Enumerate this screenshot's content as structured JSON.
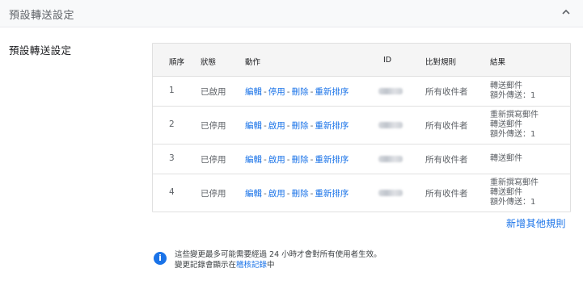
{
  "header": {
    "title": "預設轉送設定",
    "chevron_icon": "chevron-up-icon"
  },
  "section": {
    "label": "預設轉送設定"
  },
  "table": {
    "columns": [
      "順序",
      "狀態",
      "動作",
      "ID",
      "比對規則",
      "結果"
    ],
    "rows": [
      {
        "num": "1",
        "status": "已啟用",
        "actions": [
          "編輯",
          "停用",
          "刪除",
          "重新排序"
        ],
        "match": "所有收件者",
        "results": [
          "轉送郵件",
          "額外傳送：1"
        ]
      },
      {
        "num": "2",
        "status": "已停用",
        "actions": [
          "編輯",
          "啟用",
          "刪除",
          "重新排序"
        ],
        "match": "所有收件者",
        "results": [
          "重新撰寫郵件",
          "轉送郵件",
          "額外傳送：1"
        ]
      },
      {
        "num": "3",
        "status": "已停用",
        "actions": [
          "編輯",
          "啟用",
          "刪除",
          "重新排序"
        ],
        "match": "所有收件者",
        "results": [
          "轉送郵件"
        ]
      },
      {
        "num": "4",
        "status": "已停用",
        "actions": [
          "編輯",
          "啟用",
          "刪除",
          "重新排序"
        ],
        "match": "所有收件者",
        "results": [
          "重新撰寫郵件",
          "轉送郵件",
          "額外傳送：1"
        ]
      }
    ]
  },
  "add_rule": "新增其他規則",
  "note": {
    "line1": "這些變更最多可能需要經過 24 小時才會對所有使用者生效。",
    "line2_prefix": "變更記錄會顯示在",
    "line2_link": "稽核記錄",
    "line2_suffix": "中"
  },
  "colors": {
    "accent": "#1a73e8",
    "header_bg": "#f8f9fa",
    "table_head_bg": "#f5f5f5"
  }
}
